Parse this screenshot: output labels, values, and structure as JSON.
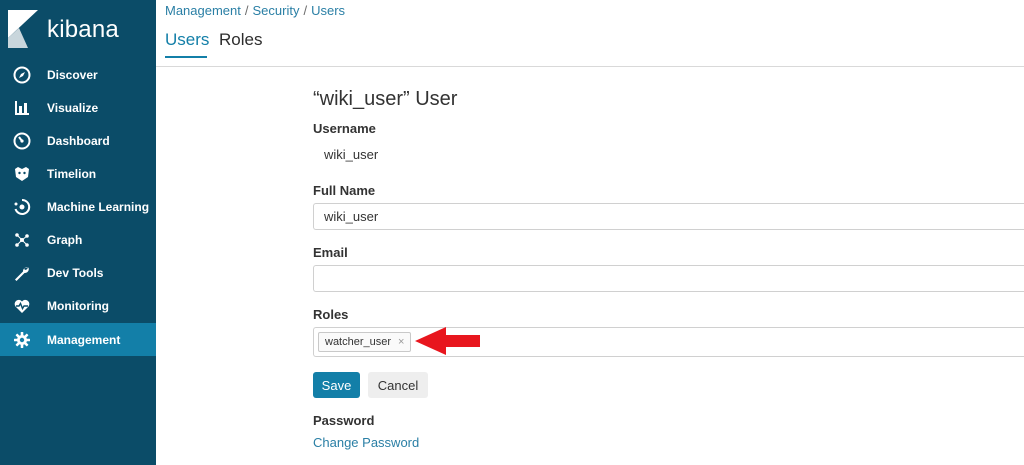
{
  "app": {
    "name": "kibana",
    "accent": "#137fa8",
    "sidebar_bg": "#0b4c68"
  },
  "nav": {
    "items": [
      {
        "label": "Discover",
        "icon": "compass-icon"
      },
      {
        "label": "Visualize",
        "icon": "bar-chart-icon"
      },
      {
        "label": "Dashboard",
        "icon": "dashboard-icon"
      },
      {
        "label": "Timelion",
        "icon": "timelion-icon"
      },
      {
        "label": "Machine Learning",
        "icon": "machine-learning-icon"
      },
      {
        "label": "Graph",
        "icon": "graph-icon"
      },
      {
        "label": "Dev Tools",
        "icon": "wrench-icon"
      },
      {
        "label": "Monitoring",
        "icon": "heartbeat-icon"
      },
      {
        "label": "Management",
        "icon": "gear-icon",
        "active": true
      }
    ]
  },
  "breadcrumb": {
    "items": [
      "Management",
      "Security",
      "Users"
    ],
    "separator": "/"
  },
  "tabs": [
    {
      "label": "Users",
      "active": true
    },
    {
      "label": "Roles",
      "active": false
    }
  ],
  "form": {
    "title": "“wiki_user” User",
    "username_label": "Username",
    "username_value": "wiki_user",
    "fullname_label": "Full Name",
    "fullname_value": "wiki_user",
    "email_label": "Email",
    "email_value": "",
    "roles_label": "Roles",
    "roles": [
      {
        "label": "watcher_user",
        "remove": "×"
      }
    ],
    "save_label": "Save",
    "cancel_label": "Cancel",
    "password_label": "Password",
    "change_password_label": "Change Password"
  },
  "annotation": {
    "arrow_color": "#e8161e"
  }
}
